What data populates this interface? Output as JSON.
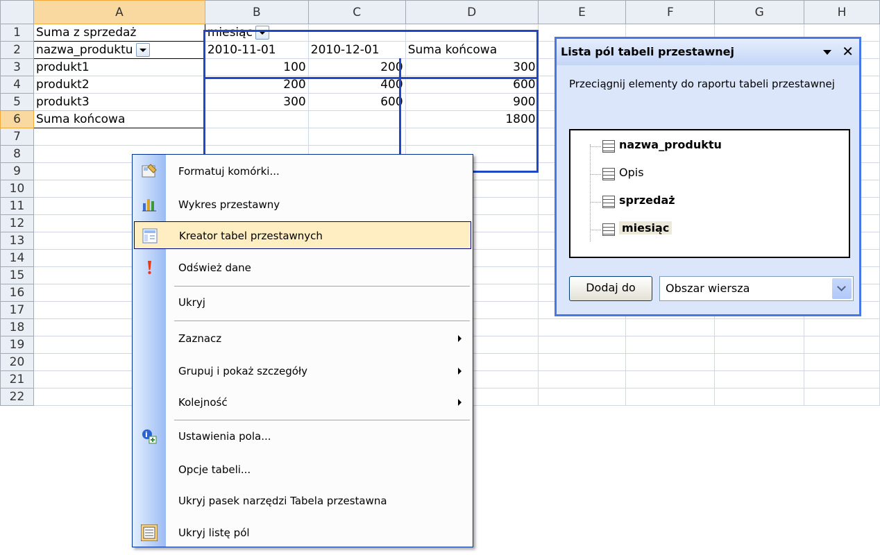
{
  "spreadsheet": {
    "columns": [
      "A",
      "B",
      "C",
      "D",
      "E",
      "F",
      "G",
      "H"
    ],
    "rows": [
      "1",
      "2",
      "3",
      "4",
      "5",
      "6",
      "7",
      "8",
      "9",
      "10",
      "11",
      "12",
      "13",
      "14",
      "15",
      "16",
      "17",
      "18",
      "19",
      "20",
      "21",
      "22"
    ],
    "cells": {
      "A1": "Suma z sprzedaż",
      "B1": "miesiąc",
      "A2": "nazwa_produktu",
      "B2": "2010-11-01",
      "C2": "2010-12-01",
      "D2": "Suma końcowa",
      "A3": "produkt1",
      "B3": "100",
      "C3": "200",
      "D3": "300",
      "A4": "produkt2",
      "B4": "200",
      "C4": "400",
      "D4": "600",
      "A5": "produkt3",
      "B5": "300",
      "C5": "600",
      "D5": "900",
      "A6": "Suma końcowa",
      "D6": "1800"
    }
  },
  "context_menu": {
    "items": [
      {
        "label": "Formatuj komórki...",
        "icon": "format-cells-icon"
      },
      {
        "label": "Wykres przestawny",
        "icon": "pivot-chart-icon"
      },
      {
        "label": "Kreator tabel przestawnych",
        "icon": "pivot-wizard-icon",
        "highlighted": true
      },
      {
        "label": "Odśwież dane",
        "icon": "exclamation-icon"
      },
      {
        "label": "Ukryj"
      },
      {
        "label": "Zaznacz",
        "submenu": true
      },
      {
        "label": "Grupuj i pokaż szczegóły",
        "submenu": true
      },
      {
        "label": "Kolejność",
        "submenu": true
      },
      {
        "label": "Ustawienia pola...",
        "icon": "field-settings-icon"
      },
      {
        "label": "Opcje tabeli..."
      },
      {
        "label": "Ukryj pasek narzędzi Tabela przestawna"
      },
      {
        "label": "Ukryj listę pól",
        "icon": "field-list-icon"
      }
    ]
  },
  "field_list": {
    "title": "Lista pól tabeli przestawnej",
    "instruction": "Przeciągnij elementy do raportu tabeli przestawnej",
    "fields": [
      {
        "name": "nazwa_produktu",
        "bold": true
      },
      {
        "name": "Opis",
        "bold": false
      },
      {
        "name": "sprzedaż",
        "bold": true
      },
      {
        "name": "miesiąc",
        "bold": true,
        "highlighted": true
      }
    ],
    "add_button": "Dodaj do",
    "area_select": "Obszar wiersza"
  },
  "colors": {
    "pivot_border": "#1f47c8",
    "menu_highlight": "#ffeec2",
    "pane_border": "#4677e4"
  }
}
